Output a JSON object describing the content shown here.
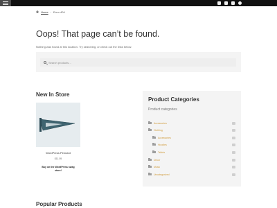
{
  "topbar": {
    "menu_icon": "hamburger-icon",
    "social_icons": [
      "facebook-icon",
      "twitter-icon",
      "instagram-icon",
      "pinterest-icon"
    ]
  },
  "breadcrumb": {
    "home_label": "Home",
    "current": "Error 404"
  },
  "page": {
    "title": "Oops! That page can’t be found.",
    "message": "Nothing was found at this location. Try searching, or check out the links below."
  },
  "search": {
    "placeholder": "Search products…"
  },
  "new_in_store": {
    "title": "New In Store",
    "product": {
      "name": "WordPress Pennant",
      "price": "$11.05",
      "button_line1": "Buy on the WordPress swag",
      "button_line2": "store!"
    }
  },
  "categories": {
    "title": "Product Categories",
    "subtitle": "Product categories",
    "items": [
      {
        "label": "Accessories",
        "level": 0
      },
      {
        "label": "Clothing",
        "level": 0
      },
      {
        "label": "Accessories",
        "level": 1
      },
      {
        "label": "Hoodies",
        "level": 1
      },
      {
        "label": "Tshirts",
        "level": 1
      },
      {
        "label": "Decor",
        "level": 0
      },
      {
        "label": "Music",
        "level": 0
      },
      {
        "label": "Uncategorized",
        "level": 0
      }
    ]
  },
  "popular": {
    "title": "Popular Products"
  },
  "colors": {
    "topbar": "#111111",
    "link": "#d09b3b",
    "panel": "#f4f4f4"
  }
}
